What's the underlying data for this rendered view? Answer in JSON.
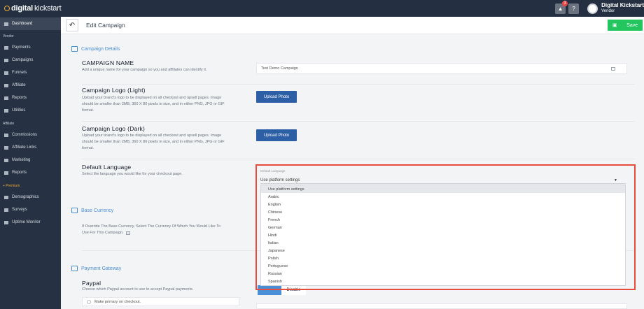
{
  "topbar": {
    "logo_bold": "digital",
    "logo_light": "kickstart",
    "notification_count": "3",
    "help_label": "?",
    "user_name": "Digital Kickstart",
    "user_role": "Vendor"
  },
  "sidebar": {
    "dashboard": "Dashboard",
    "vendor_header": "Vendor",
    "vendor_items": [
      "Payments",
      "Campaigns",
      "Funnels",
      "Affiliate",
      "Reports",
      "Utilities"
    ],
    "affiliate_header": "Affiliate",
    "affiliate_items": [
      "Commissions",
      "Affiliate Links",
      "Marketing",
      "Reports"
    ],
    "premium_header": "+ Premium",
    "premium_items": [
      "Demographics",
      "Surveys",
      "Uptime Monitor"
    ]
  },
  "header": {
    "title": "Edit Campaign",
    "save_label": "Save"
  },
  "sections": {
    "campaign_details": "Campaign Details",
    "base_currency": "Base Currency",
    "payment_gateway": "Payment Gateway"
  },
  "fields": {
    "campaign_name_title": "CAMPAIGN NAME",
    "campaign_name_desc": "Add a unique name for your campaign so you and affiliates can identify it.",
    "campaign_name_value": "Test Demo Campaign",
    "logo_light_title": "Campaign Logo (Light)",
    "logo_light_desc_1": "Upload your brand's logo to be displayed on all checkout and upsell pages. Image",
    "logo_light_desc_2": "should be smaller than 2MB, 360 X 80 pixels in size, and in either PNG, JPG or GIF",
    "logo_light_desc_3": "format.",
    "logo_dark_title": "Campaign Logo (Dark)",
    "logo_dark_desc_1": "Upload your brand's logo to be displayed on all checkout and upsell pages. Image",
    "logo_dark_desc_2": "should be smaller than 2MB, 360 X 80 pixels in size, and in either PNG, JPG or GIF",
    "logo_dark_desc_3": "format.",
    "upload_label": "Upload Photo",
    "language_title": "Default Language",
    "language_desc": "Select the language you would like for your checkout page.",
    "currency_desc_1": "If Override The Base Currency, Select The Currency Of Which You Would Like To",
    "currency_desc_2": "Use For This Campaign.",
    "paypal_title": "Paypal",
    "paypal_desc": "Choose which Paypal account to use to accept Paypal payments.",
    "make_primary": "Make primary on checkout.",
    "disable_label": "Disable"
  },
  "language_dropdown": {
    "label": "Default Language",
    "selected": "Use platform settings",
    "options": [
      "Use platform settings",
      "Arabic",
      "English",
      "Chinese",
      "French",
      "German",
      "Hindi",
      "Italian",
      "Japanese",
      "Polish",
      "Portuguese",
      "Russian",
      "Spanish"
    ]
  },
  "colors": {
    "sidebar_bg": "#263244",
    "accent_blue": "#4a8fd6",
    "save_green": "#22c55e",
    "highlight_red": "#e74c3c"
  }
}
